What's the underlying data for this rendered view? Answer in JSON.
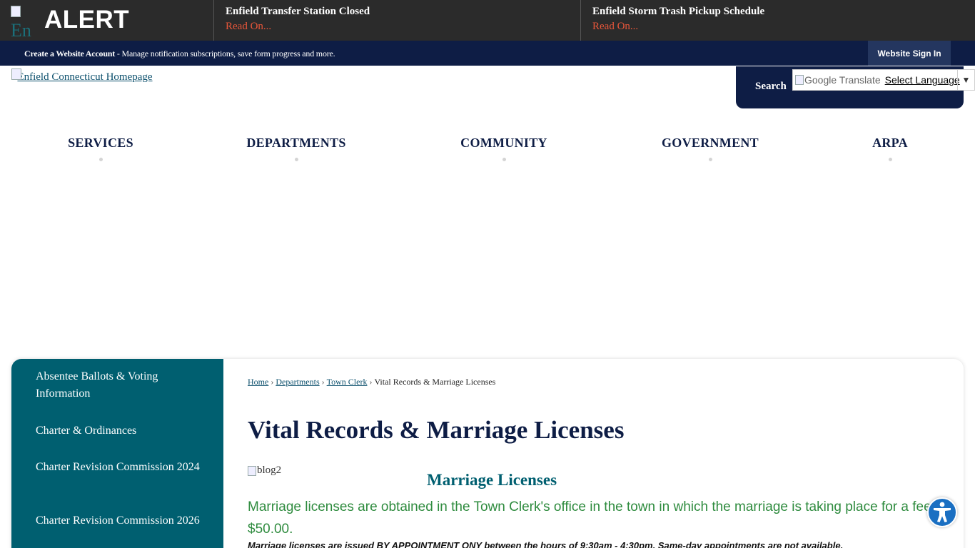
{
  "alert_bar": {
    "logo_alt": "En",
    "alert_word": "ALERT",
    "items": [
      {
        "title": "Enfield Transfer Station Closed",
        "link": "Read On..."
      },
      {
        "title": "Enfield Storm Trash Pickup Schedule",
        "link": "Read On..."
      }
    ]
  },
  "account_bar": {
    "create_account": "Create a Website Account",
    "message": " - Manage notification subscriptions, save form progress and more.",
    "sign_in": "Website Sign In"
  },
  "header": {
    "logo_text": "Enfield Connecticut Homepage",
    "search_label": "Search",
    "translate_img": "Google Translate",
    "translate_select": "Select Language",
    "translate_arrow": "▼"
  },
  "nav": {
    "items": [
      "SERVICES",
      "DEPARTMENTS",
      "COMMUNITY",
      "GOVERNMENT",
      "ARPA"
    ]
  },
  "sidebar": {
    "items": [
      "Absentee Ballots & Voting Information",
      "Charter & Ordinances",
      "Charter Revision Commission 2024",
      "Charter Revision Commission 2026"
    ]
  },
  "breadcrumb": {
    "home": "Home",
    "departments": "Departments",
    "town_clerk": "Town Clerk",
    "current": "Vital Records & Marriage Licenses",
    "sep": "›"
  },
  "main": {
    "title": "Vital Records & Marriage Licenses",
    "image_alt": "blog2",
    "section_heading": "Marriage Licenses",
    "paragraph_1": "Marriage licenses are obtained in the Town Clerk's office in the town in which the marriage is taking place for a fee of $50.00.",
    "paragraph_2": "Marriage licenses are issued BY APPOINTMENT ONY between the hours of 9:30am - 4:30pm. Same-day appointments are not available."
  },
  "colors": {
    "navy": "#0e1d45",
    "teal": "#005f70",
    "alert_red": "#e8563a",
    "green_text": "#2e8b3e"
  }
}
